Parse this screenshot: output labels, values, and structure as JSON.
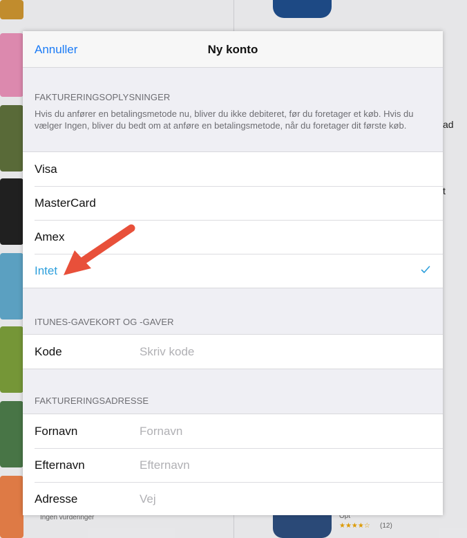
{
  "background": {
    "side_text_1": "ad",
    "side_text_2": "t",
    "bottom_left_text": "Ingen vurderinger",
    "bottom_right_partial": "Opt",
    "bottom_right_stars": "★★★★☆",
    "bottom_right_count": "(12)"
  },
  "navbar": {
    "cancel_label": "Annuller",
    "title": "Ny konto"
  },
  "billing": {
    "header": "FAKTURERINGSOPLYSNINGER",
    "description": "Hvis du anfører en betalingsmetode nu, bliver du ikke debiteret, før du foretager et køb. Hvis du vælger Ingen, bliver du bedt om at anføre en betalingsmetode, når du foretager dit første køb.",
    "options": [
      "Visa",
      "MasterCard",
      "Amex",
      "Intet"
    ],
    "selected": "Intet"
  },
  "giftcards": {
    "header": "ITUNES-GAVEKORT OG -GAVER",
    "code_label": "Kode",
    "code_placeholder": "Skriv kode",
    "code_value": ""
  },
  "address": {
    "header": "FAKTURERINGSADRESSE",
    "fields": [
      {
        "label": "Fornavn",
        "placeholder": "Fornavn",
        "value": ""
      },
      {
        "label": "Efternavn",
        "placeholder": "Efternavn",
        "value": ""
      },
      {
        "label": "Adresse",
        "placeholder": "Vej",
        "value": ""
      }
    ]
  },
  "colors": {
    "accent": "#1a7bf6",
    "selected": "#2d9fdc",
    "annotation_arrow": "#e8503a"
  },
  "icons": {
    "selected_mark": "checkmark-icon",
    "annotation": "red-arrow-icon"
  }
}
